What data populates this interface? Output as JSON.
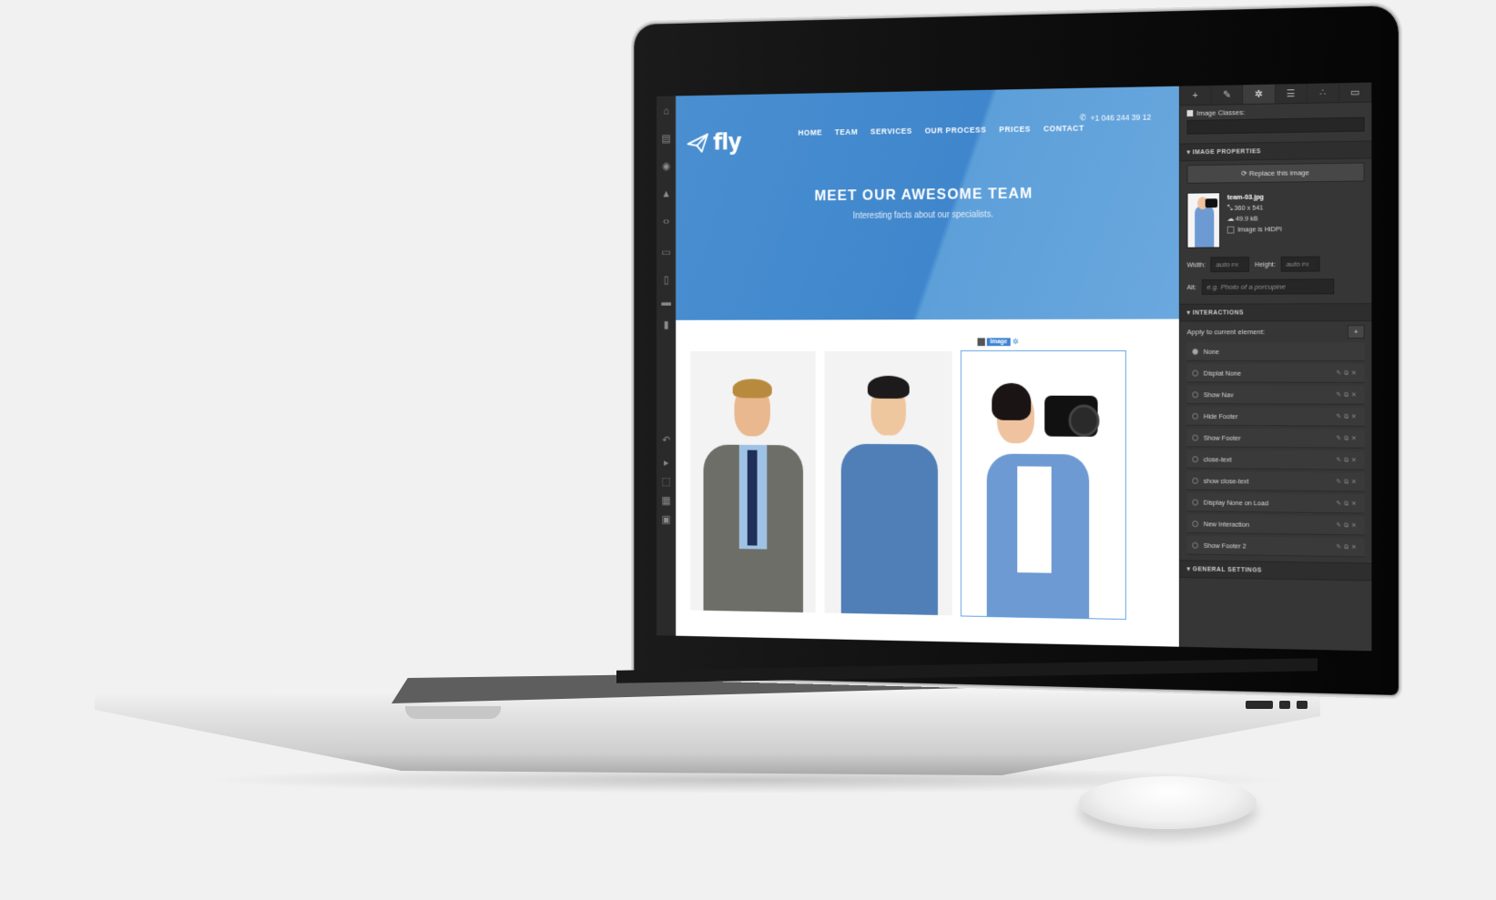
{
  "site": {
    "logo_text": "fly",
    "nav": [
      "HOME",
      "TEAM",
      "SERVICES",
      "OUR PROCESS",
      "PRICES",
      "CONTACT"
    ],
    "phone": "+1 046 244 39 12",
    "hero_title": "MEET OUR AWESOME TEAM",
    "hero_subtitle": "Interesting facts about our specialists.",
    "selection_tag": "Image"
  },
  "panel": {
    "tabs": [
      "+",
      "brush-icon",
      "gear-icon",
      "list-icon",
      "drops-icon",
      "folder-icon"
    ],
    "image_classes_label": "Image Classes:",
    "image_properties_header": "IMAGE PROPERTIES",
    "replace_button": "Replace this image",
    "file_name": "team-03.jpg",
    "dimensions": "360 x 541",
    "file_size": "49.9 kB",
    "hidpi_label": "Image is HiDPI",
    "width_label": "Width:",
    "width_value": "auto",
    "height_label": "Height:",
    "height_value": "auto",
    "unit": "PX",
    "alt_label": "Alt:",
    "alt_placeholder": "e.g. Photo of a porcupine",
    "interactions_header": "INTERACTIONS",
    "apply_label": "Apply to current element:",
    "interactions": [
      "None",
      "Displat None",
      "Show Nav",
      "Hide Footer",
      "Show Footer",
      "close-text",
      "show close-text",
      "Display None on Load",
      "New Interaction",
      "Show Footer 2"
    ],
    "general_header": "GENERAL SETTINGS"
  },
  "colors": {
    "hero_blue": "#4a8fd0",
    "panel_dark": "#363636",
    "selection_blue": "#3a82d4"
  }
}
